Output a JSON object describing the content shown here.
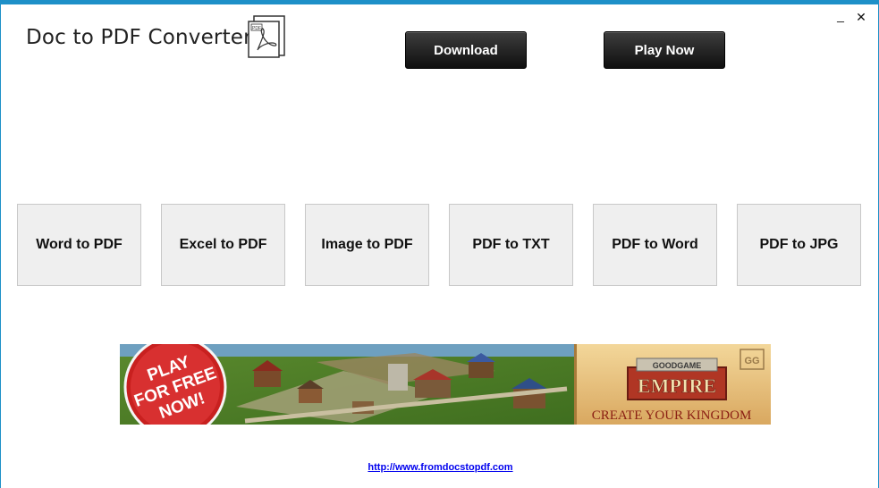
{
  "app": {
    "title": "Doc to PDF Converter"
  },
  "window_controls": {
    "minimize": "_",
    "close": "✕"
  },
  "header": {
    "download_label": "Download",
    "play_now_label": "Play Now",
    "pdf_icon_text": "PDF"
  },
  "tools": [
    {
      "label": "Word to PDF"
    },
    {
      "label": "Excel to PDF"
    },
    {
      "label": "Image to PDF"
    },
    {
      "label": "PDF to TXT"
    },
    {
      "label": "PDF to Word"
    },
    {
      "label": "PDF to JPG"
    }
  ],
  "banner": {
    "badge_line1": "PLAY",
    "badge_line2": "FOR FREE",
    "badge_line3": "NOW!",
    "brand_small": "GOODGAME",
    "brand_big": "EMPIRE",
    "tagline": "CREATE YOUR KINGDOM",
    "logo_mark": "GG"
  },
  "footer": {
    "link_text": "http://www.fromdocstopdf.com"
  },
  "colors": {
    "accent": "#1e90c8",
    "button_dark": "#1a1a1a",
    "tile_bg": "#efefef",
    "banner_red": "#d42a2a",
    "banner_gold": "#e8c27a"
  }
}
